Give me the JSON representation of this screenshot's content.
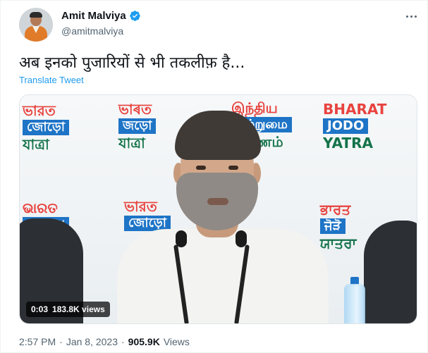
{
  "author": {
    "name": "Amit Malviya",
    "handle": "@amitmalviya",
    "verified": true
  },
  "tweet": {
    "text": "अब इनको पुजारियों से भी तकलीफ़ है...",
    "translate_label": "Translate Tweet"
  },
  "video": {
    "elapsed": "0:03",
    "views": "183.8K views",
    "banners": [
      {
        "line1": "ভারত",
        "line2": "জোড়ো",
        "line3": "যাত্রা"
      },
      {
        "line1": "ভাৰত",
        "line2": "জড়ো",
        "line3": "যাত্রা"
      },
      {
        "line1": "இந்திய",
        "line2": "ஒற்றுமை",
        "line3": "பயணம்"
      },
      {
        "line1": "BHARAT",
        "line2": "JODO",
        "line3": "YATRA"
      },
      {
        "line1": "ଭାରତ",
        "line2": "ଯୋଡ଼ୋ",
        "line3": ""
      },
      {
        "line1": "ভারত",
        "line2": "জোড়ো",
        "line3": ""
      },
      {
        "line1": "ਭਾਰਤ",
        "line2": "ਜੋੜੋ",
        "line3": "ਯਾਤਰਾ"
      }
    ]
  },
  "meta": {
    "time": "2:57 PM",
    "date": "Jan 8, 2023",
    "views_count": "905.9K",
    "views_label": "Views",
    "separator": "·"
  },
  "colors": {
    "link": "#1d9bf0",
    "verified": "#1d9bf0",
    "secondary_text": "#536471"
  }
}
